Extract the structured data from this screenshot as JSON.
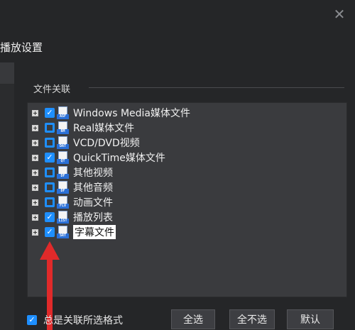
{
  "window": {
    "close_glyph": "✕"
  },
  "header": {
    "title": "播放设置"
  },
  "section": {
    "label": "文件关联"
  },
  "file_types": [
    {
      "label": "Windows Media媒体文件",
      "checked": true,
      "icon_tag": "ASF",
      "selected": false
    },
    {
      "label": "Real媒体文件",
      "checked": false,
      "icon_tag": "RM",
      "selected": false
    },
    {
      "label": "VCD/DVD视频",
      "checked": false,
      "icon_tag": "DAT",
      "selected": false
    },
    {
      "label": "QuickTime媒体文件",
      "checked": true,
      "icon_tag": "QT",
      "selected": false
    },
    {
      "label": "其他视频",
      "checked": false,
      "icon_tag": "DF",
      "selected": false
    },
    {
      "label": "其他音频",
      "checked": false,
      "icon_tag": "DF",
      "selected": false
    },
    {
      "label": "动画文件",
      "checked": false,
      "icon_tag": "FLV",
      "selected": false
    },
    {
      "label": "播放列表",
      "checked": true,
      "icon_tag": "LIST",
      "selected": false
    },
    {
      "label": "字幕文件",
      "checked": true,
      "icon_tag": "SRT",
      "selected": true
    }
  ],
  "footer": {
    "always_associate_label": "总是关联所选格式",
    "always_associate_checked": true,
    "select_all_label": "全选",
    "select_none_label": "全不选",
    "default_label": "默认"
  },
  "colors": {
    "accent": "#1e8fff",
    "background": "#252628",
    "panel": "#3a3b3e",
    "annotation_arrow": "#e02a2a"
  }
}
